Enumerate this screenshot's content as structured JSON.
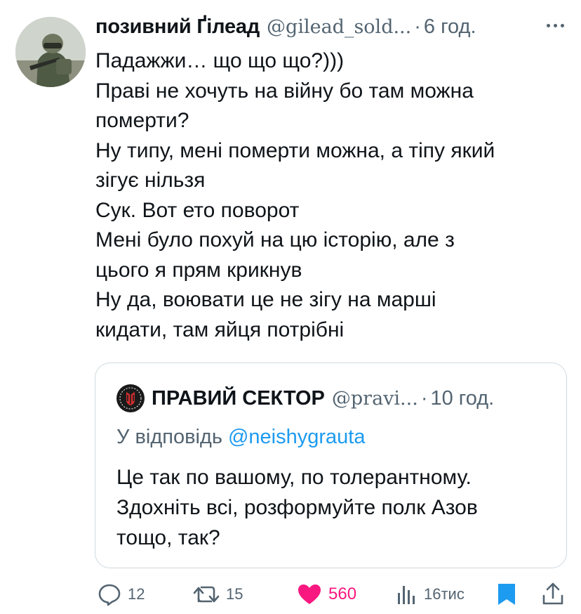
{
  "author": {
    "name": "позивний Ґілеад",
    "handle": "@gilead_sold...",
    "separator": "·",
    "time": "6 год."
  },
  "tweet_lines": [
    "Падажжи… що що що?)))",
    "Праві не хочуть на війну бо там можна",
    "померти?",
    "Ну типу, мені померти можна, а тіпу який",
    "зігує нільзя",
    "Сук. Вот ето поворот",
    "Мені було похуй на цю історію, але з",
    "цього я прям крикнув",
    "Ну да, воювати це не зігу на марші",
    "кидати, там яйця потрібні"
  ],
  "quote": {
    "name": "ПРАВИЙ СЕКТОР",
    "handle": "@pravi...",
    "separator": "·",
    "time": "10 год.",
    "reply_prefix": "У відповідь",
    "reply_mention": "@neishygrauta",
    "lines": [
      "Це так по вашому, по толерантному.",
      "Здохніть всі, розформуйте полк Азов",
      "тощо, так?"
    ]
  },
  "actions": {
    "replies": "12",
    "retweets": "15",
    "likes": "560",
    "views": "16тис"
  },
  "colors": {
    "text": "#0f1419",
    "secondary": "#536471",
    "link": "#1d9bf0",
    "like": "#f91880",
    "bookmark": "#1d9bf0",
    "border": "#cfd9de"
  },
  "icons": [
    "more-icon",
    "reply-icon",
    "retweet-icon",
    "heart-icon",
    "views-icon",
    "bookmark-icon",
    "share-icon"
  ]
}
